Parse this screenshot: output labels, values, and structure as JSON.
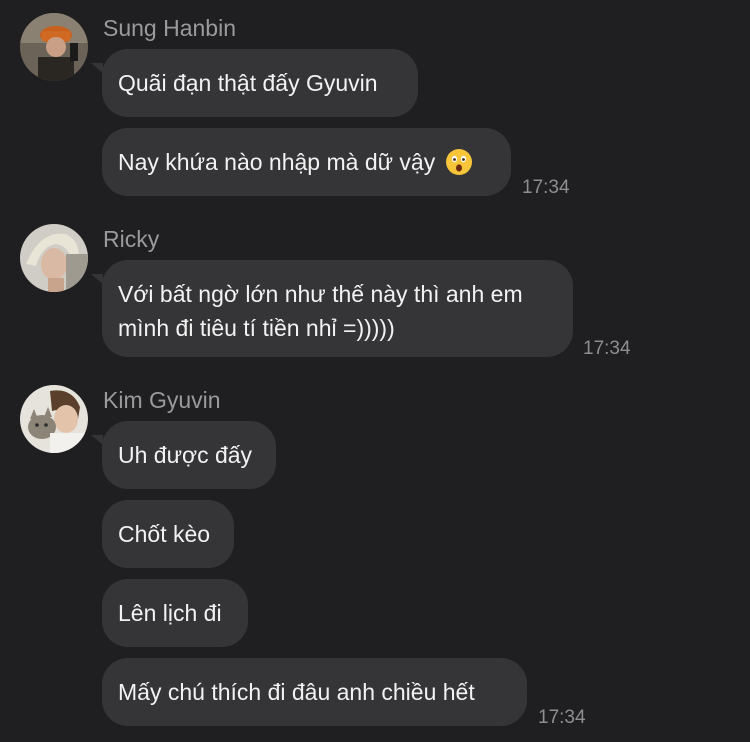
{
  "groups": [
    {
      "sender": "Sung Hanbin",
      "avatar_icon": "profile-photo-sung-hanbin",
      "messages": [
        "Quãi đạn thật đấy Gyuvin",
        "Nay khứa nào nhập mà dữ vậy"
      ],
      "emoji": "astonished-face-icon",
      "time": "17:34"
    },
    {
      "sender": "Ricky",
      "avatar_icon": "profile-photo-ricky",
      "messages": [
        {
          "line1": "Với bất ngờ lớn như thế này thì anh em",
          "line2": "mình đi tiêu tí tiền nhỉ =)))))"
        }
      ],
      "time": "17:34"
    },
    {
      "sender": "Kim Gyuvin",
      "avatar_icon": "profile-photo-kim-gyuvin",
      "messages": [
        "Uh được đấy",
        "Chốt kèo",
        "Lên lịch đi",
        "Mấy chú thích đi đâu anh chiều hết"
      ],
      "time": "17:34"
    }
  ],
  "colors": {
    "background": "#1f1f21",
    "bubble": "#353538",
    "sender_text": "#9a9a9e",
    "time_text": "#8e8e93"
  }
}
